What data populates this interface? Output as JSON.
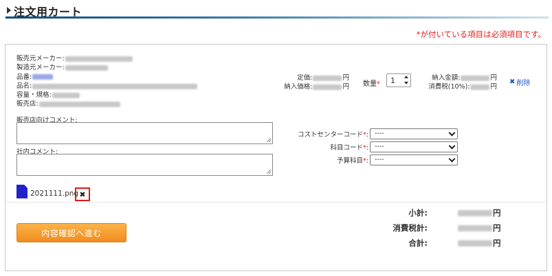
{
  "page": {
    "title": "注文用カート",
    "required_note": "*が付いている項目は必須項目です。"
  },
  "product": {
    "seller_maker_label": "販売元メーカー:",
    "manufacturer_label": "製造元メーカー:",
    "part_no_label": "品番:",
    "name_label": "品名:",
    "capacity_label": "容量・規格:",
    "store_label": "販売店:"
  },
  "pricing": {
    "list_price_label": "定価:",
    "list_price_unit": "円",
    "purchase_price_label": "納入価格:",
    "purchase_price_unit": "円",
    "quantity_label": "数量",
    "required_mark": "*",
    "quantity_value": "1",
    "delivery_amount_label": "納入金額:",
    "delivery_amount_unit": "円",
    "tax_label": "消費税(10%):",
    "tax_unit": "円",
    "delete_label": "削除",
    "delete_icon_glyph": "✖"
  },
  "comments": {
    "store_comment_label": "販売店向けコメント:",
    "internal_comment_label": "社内コメント:"
  },
  "selects": {
    "cost_center_label": "コストセンターコード",
    "cost_center_value": "----",
    "account_code_label": "科目コード",
    "account_code_value": "----",
    "budget_item_label": "予算科目",
    "budget_item_value": "----"
  },
  "attachment": {
    "file_name": "2021111.png",
    "delete_glyph": "✖"
  },
  "summary": {
    "subtotal_label": "小計:",
    "tax_label": "消費税計:",
    "total_label": "合計:",
    "unit": "円"
  },
  "actions": {
    "proceed_label": "内容確認へ進む"
  },
  "colors": {
    "accent_orange": "#f28c1e",
    "required_red": "#e02020",
    "link_blue": "#1a57c9",
    "highlight_red": "#e01818"
  }
}
